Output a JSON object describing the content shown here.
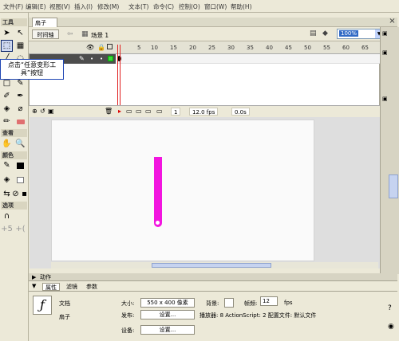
{
  "menubar": {
    "items": [
      "文件(F)",
      "编辑(E)",
      "视图(V)",
      "插入(I)",
      "修改(M)",
      "文本(T)",
      "命令(C)",
      "控制(O)",
      "窗口(W)",
      "帮助(H)"
    ]
  },
  "toolbox": {
    "title": "工具",
    "view_label": "查看",
    "colors_label": "颜色",
    "options_label": "选项"
  },
  "document": {
    "tab": "扇子",
    "close_icon": "close-icon"
  },
  "doc_toolbar": {
    "timeline_button": "时间轴",
    "scene_label": "场景 1",
    "zoom_value": "100%"
  },
  "timeline": {
    "frame_numbers": [
      "5",
      "10",
      "15",
      "20",
      "25",
      "30",
      "35",
      "40",
      "45",
      "50",
      "55",
      "60",
      "65"
    ],
    "current_frame": "1",
    "fps": "12.0 fps",
    "time": "0.0s"
  },
  "tooltip": {
    "text": "点击“任意变形工具”按钮"
  },
  "panels": {
    "actions_label": "动作",
    "properties_tabs": [
      "属性",
      "滤镜",
      "参数"
    ]
  },
  "properties": {
    "doc_type": "文档",
    "doc_name": "扇子",
    "size_label": "大小:",
    "size_value": "550 x 400 像素",
    "bg_label": "背景:",
    "fps_label": "帧频:",
    "fps_value": "12",
    "fps_unit": "fps",
    "publish_label": "发布:",
    "publish_btn": "设置...",
    "player_text": "播放器: 8  ActionScript: 2  配置文件: 默认文件",
    "settings_label": "设备:",
    "settings_btn": "设置..."
  },
  "colors": {
    "shape_fill": "#f215df"
  }
}
